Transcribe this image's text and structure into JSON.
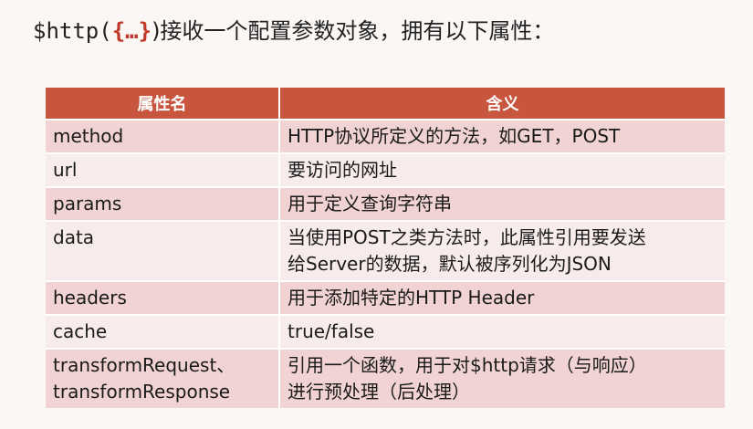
{
  "heading": {
    "prefix": "$http(",
    "accent": "{…}",
    "suffix": ")接收一个配置参数对象，拥有以下属性："
  },
  "table": {
    "headers": [
      "属性名",
      "含义"
    ],
    "rows": [
      {
        "name": [
          "method"
        ],
        "meaning": [
          "HTTP协议所定义的方法，如GET，POST"
        ]
      },
      {
        "name": [
          "url"
        ],
        "meaning": [
          "要访问的网址"
        ]
      },
      {
        "name": [
          "params"
        ],
        "meaning": [
          "用于定义查询字符串"
        ]
      },
      {
        "name": [
          "data"
        ],
        "meaning": [
          "当使用POST之类方法时，此属性引用要发送",
          "给Server的数据，默认被序列化为JSON"
        ]
      },
      {
        "name": [
          "headers"
        ],
        "meaning": [
          "用于添加特定的HTTP Header"
        ]
      },
      {
        "name": [
          "cache"
        ],
        "meaning": [
          "true/false"
        ]
      },
      {
        "name": [
          "transformRequest、",
          "transformResponse"
        ],
        "meaning": [
          "引用一个函数，用于对$http请求（与响应）",
          "进行预处理（后处理）"
        ]
      }
    ]
  }
}
